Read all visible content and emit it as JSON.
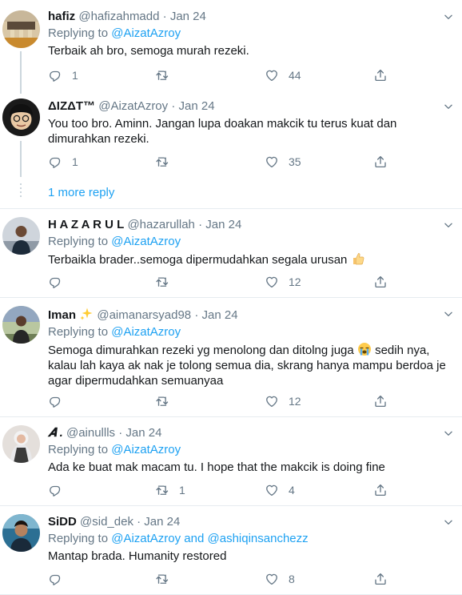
{
  "tweets": [
    {
      "name": "hafiz",
      "handle": "@hafizahmadd",
      "date": "Jan 24",
      "replying_label": "Replying to",
      "mentions": "@AizatAzroy",
      "text": "Terbaik ah bro, semoga murah rezeki.",
      "replies": "1",
      "retweets": "",
      "likes": "44"
    },
    {
      "name": "ΔIZΔT™",
      "handle": "@AizatAzroy",
      "date": "Jan 24",
      "text": "You too bro. Aminn. Jangan lupa doakan makcik tu terus kuat dan dimurahkan rezeki.",
      "replies": "1",
      "retweets": "",
      "likes": "35"
    },
    {
      "name": "H A Z A R U L",
      "handle": "@hazarullah",
      "date": "Jan 24",
      "replying_label": "Replying to",
      "mentions": "@AizatAzroy",
      "text": "Terbaikla brader..semoga dipermudahkan segala urusan",
      "replies": "",
      "retweets": "",
      "likes": "12"
    },
    {
      "name": "Iman",
      "handle": "@aimanarsyad98",
      "date": "Jan 24",
      "replying_label": "Replying to",
      "mentions": "@AizatAzroy",
      "text": "Semoga dimurahkan rezeki yg menolong dan ditolng juga",
      "text_cont": "sedih nya, kalau lah kaya ak nak je tolong semua dia, skrang hanya mampu berdoa je agar dipermudahkan semuanyaa",
      "replies": "",
      "retweets": "",
      "likes": "12"
    },
    {
      "name": "𝑨 .",
      "handle": "@ainullls",
      "date": "Jan 24",
      "replying_label": "Replying to",
      "mentions": "@AizatAzroy",
      "text": "Ada ke buat mak macam tu. I hope that the makcik is doing fine",
      "replies": "",
      "retweets": "1",
      "likes": "4"
    },
    {
      "name": "SiDD",
      "handle": "@sid_dek",
      "date": "Jan 24",
      "replying_label": "Replying to",
      "mentions": "@AizatAzroy and @ashiqinsanchezz",
      "text": "Mantap brada. Humanity restored",
      "replies": "",
      "retweets": "",
      "likes": "8"
    }
  ],
  "more_reply_label": "1 more reply",
  "dot": "·",
  "colors": {
    "link": "#1da1f2",
    "secondary": "#657786",
    "text": "#14171a",
    "divider": "#e6ecf0",
    "thread": "#ccd6dd"
  },
  "icons": [
    "reply-icon",
    "retweet-icon",
    "like-icon",
    "share-icon",
    "chevron-down-icon",
    "sparkles-emoji",
    "thumbs-up-emoji",
    "crying-emoji"
  ]
}
